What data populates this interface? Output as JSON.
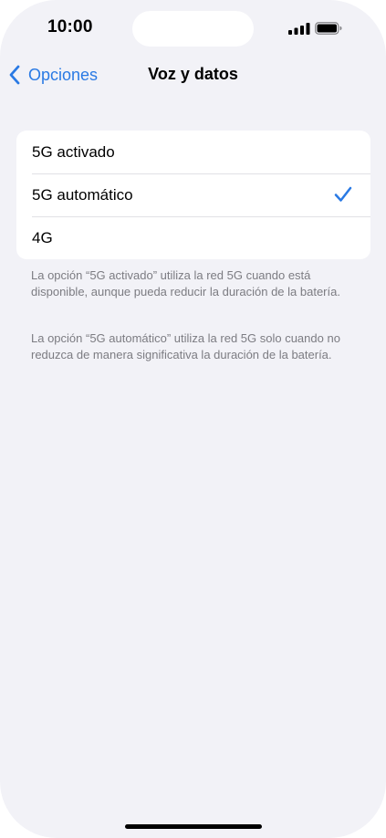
{
  "status_bar": {
    "time": "10:00",
    "icons": [
      "signal-icon",
      "battery-icon"
    ]
  },
  "nav": {
    "back_label": "Opciones",
    "title": "Voz y datos"
  },
  "options": [
    {
      "label": "5G activado",
      "selected": false
    },
    {
      "label": "5G automático",
      "selected": true
    },
    {
      "label": "4G",
      "selected": false
    }
  ],
  "footnotes": {
    "first": "La opción “5G activado” utiliza la red 5G cuando está disponible, aunque pueda reducir la duración de la batería.",
    "second": "La opción “5G automático” utiliza la red 5G solo cuando no reduzca de manera significativa la duración de la batería."
  },
  "colors": {
    "accent": "#2a7ae4",
    "background": "#f2f2f7",
    "footnote_text": "#7c7c82"
  }
}
